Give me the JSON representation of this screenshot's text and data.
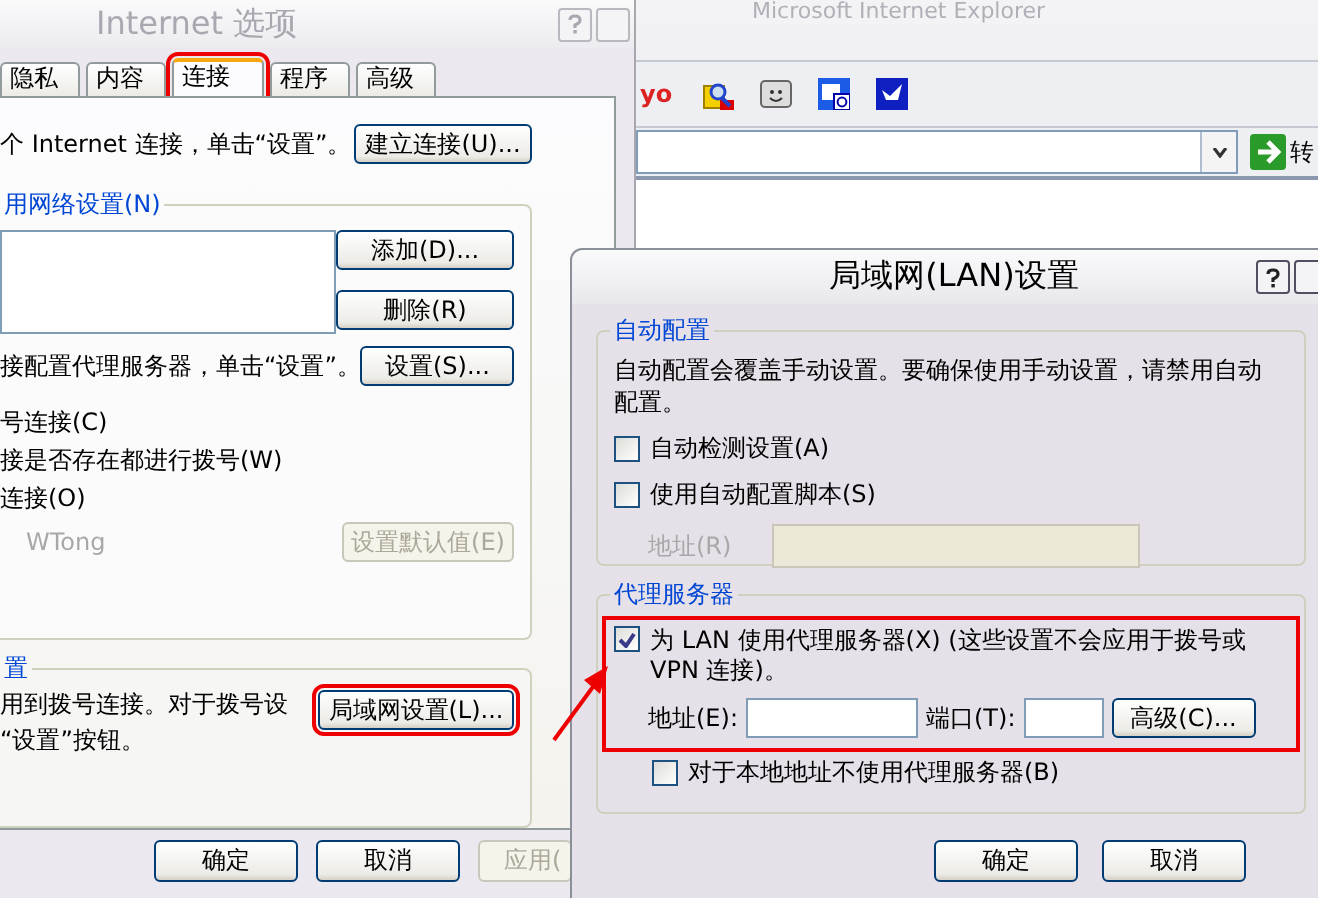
{
  "browser_window": {
    "title": "Microsoft Internet Explorer",
    "logo_fragment": "yo",
    "go_label": "转"
  },
  "options_dialog": {
    "title": "Internet 选项",
    "tabs": [
      {
        "label": "隐私",
        "selected": false,
        "highlighted": false
      },
      {
        "label": "内容",
        "selected": false,
        "highlighted": false
      },
      {
        "label": "连接",
        "selected": true,
        "highlighted": true
      },
      {
        "label": "程序",
        "selected": false,
        "highlighted": false
      },
      {
        "label": "高级",
        "selected": false,
        "highlighted": false
      }
    ],
    "setup_text": "个 Internet 连接，单击“设置”。",
    "setup_button": "建立连接(U)...",
    "dialup_group": {
      "title": "用网络设置(N)",
      "add_button": "添加(D)...",
      "remove_button": "删除(R)",
      "proxy_hint": "接配置代理服务器，单击“设置”。",
      "settings_button": "设置(S)...",
      "dial_options": [
        "号连接(C)",
        "接是否存在都进行拨号(W)",
        "连接(O)"
      ],
      "default_connection": "WTong",
      "default_button": {
        "label": "设置默认值(E)",
        "disabled": true
      }
    },
    "lan_group": {
      "title": "置",
      "lines": [
        "用到拨号连接。对于拨号设",
        "“设置”按钮。"
      ],
      "lan_button": {
        "label": "局域网设置(L)...",
        "highlighted": true
      }
    },
    "buttons": [
      {
        "label": "确定",
        "disabled": false
      },
      {
        "label": "取消",
        "disabled": false
      },
      {
        "label": "应用(",
        "disabled": true
      }
    ]
  },
  "lan_dialog": {
    "title": "局域网(LAN)设置",
    "auto_group": {
      "title": "自动配置",
      "text": "自动配置会覆盖手动设置。要确保使用手动设置，请禁用自动配置。",
      "checkboxes": [
        {
          "label": "自动检测设置(A)",
          "checked": false
        },
        {
          "label": "使用自动配置脚本(S)",
          "checked": false
        }
      ],
      "address_label": "地址(R)",
      "address_disabled": true
    },
    "proxy_group": {
      "title": "代理服务器",
      "highlighted": true,
      "use_proxy": {
        "label": "为 LAN 使用代理服务器(X) (这些设置不会应用于拨号或 VPN 连接)。",
        "checked": true
      },
      "address_label": "地址(E):",
      "port_label": "端口(T):",
      "advanced_button": "高级(C)...",
      "bypass_local": {
        "label": "对于本地地址不使用代理服务器(B)",
        "checked": false
      }
    },
    "buttons": [
      "确定",
      "取消"
    ]
  }
}
